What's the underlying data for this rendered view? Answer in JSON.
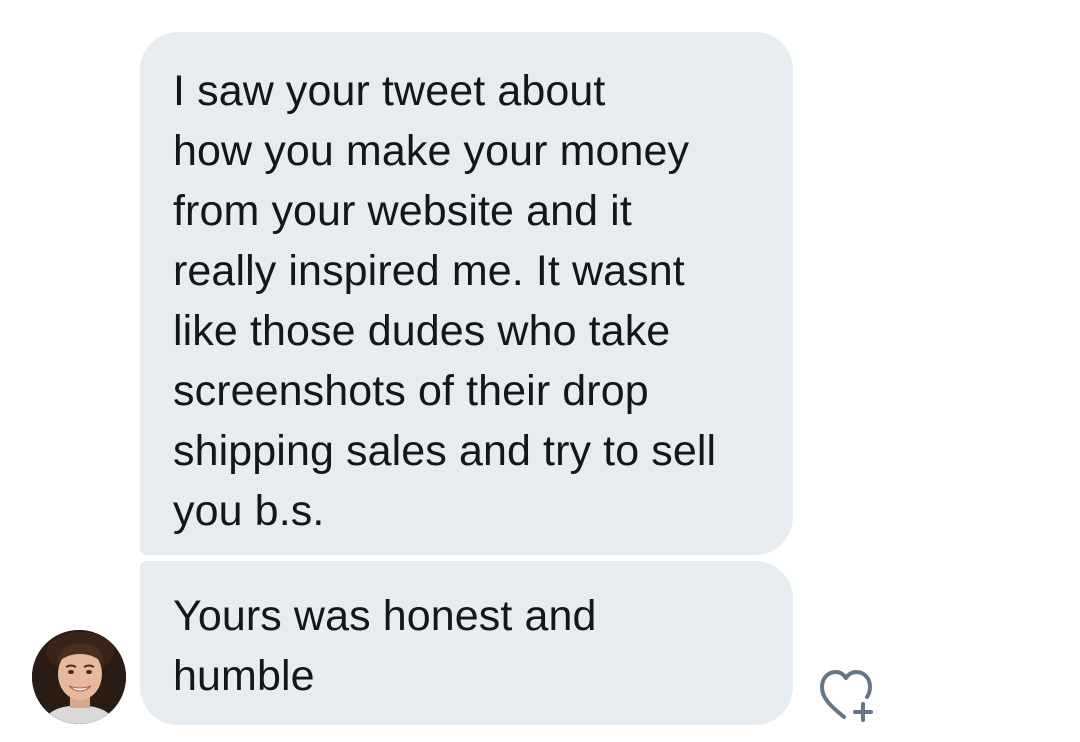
{
  "conversation": {
    "messages": [
      {
        "text": "I saw your tweet about\nhow you make your money\nfrom your website and it\nreally inspired me. It wasnt\nlike those dudes who take\nscreenshots of their drop\nshipping sales and try to sell\nyou b.s."
      },
      {
        "text": "Yours was honest and\nhumble"
      }
    ],
    "sender": {
      "avatar_icon": "user-avatar-photo"
    },
    "like_action": {
      "icon": "heart-plus-icon"
    }
  },
  "colors": {
    "bubble_bg": "#e6ecf0",
    "text": "#14171a",
    "icon": "#657786",
    "page_bg": "#ffffff"
  }
}
